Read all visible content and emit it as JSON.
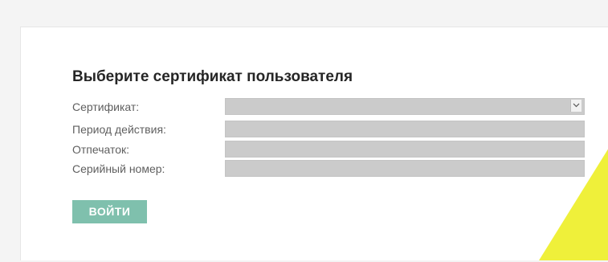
{
  "form": {
    "title": "Выберите сертификат пользователя",
    "fields": [
      {
        "label": "Сертификат:",
        "value": ""
      },
      {
        "label": "Период действия:",
        "value": ""
      },
      {
        "label": "Отпечаток:",
        "value": ""
      },
      {
        "label": "Серийный номер:",
        "value": ""
      }
    ],
    "login_label": "ВОЙТИ"
  },
  "colors": {
    "button": "#7fc0ad",
    "accent": "#eff03a",
    "field_fill": "#cbcbcb"
  },
  "icons": {
    "certificate_select": "chevron-down-icon"
  }
}
